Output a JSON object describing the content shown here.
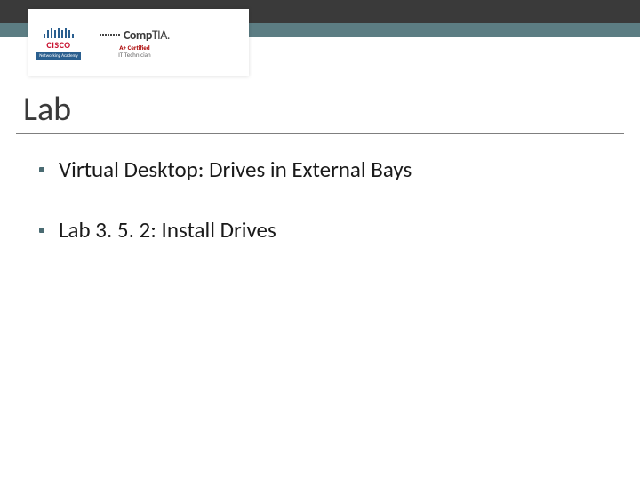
{
  "logos": {
    "cisco": {
      "brand": "CISCO",
      "subline": "Networking Academy"
    },
    "comptia": {
      "brand_comp": "Comp",
      "brand_tia": "TIA.",
      "cert_line1": "A+ Certified",
      "cert_line2": "IT Technician"
    }
  },
  "title": "Lab",
  "bullets": [
    "Virtual Desktop: Drives in External Bays",
    "Lab 3. 5. 2: Install Drives"
  ]
}
